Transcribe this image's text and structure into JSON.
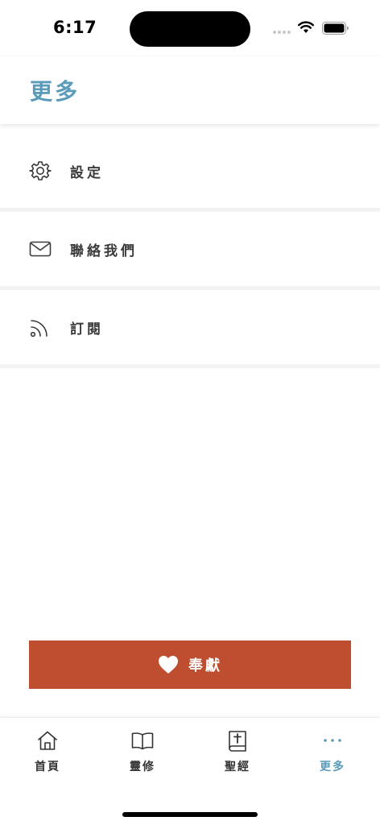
{
  "status_bar": {
    "time": "6:17"
  },
  "header": {
    "title": "更多"
  },
  "menu": {
    "items": [
      {
        "label": "設定",
        "icon": "gear-icon"
      },
      {
        "label": "聯絡我們",
        "icon": "mail-icon"
      },
      {
        "label": "訂閱",
        "icon": "rss-icon"
      }
    ]
  },
  "offering": {
    "label": "奉獻",
    "icon": "heart-icon"
  },
  "tab_bar": {
    "tabs": [
      {
        "label": "首頁",
        "icon": "home-icon"
      },
      {
        "label": "靈修",
        "icon": "book-icon"
      },
      {
        "label": "聖經",
        "icon": "bible-icon"
      },
      {
        "label": "更多",
        "icon": "more-icon",
        "active": true
      }
    ]
  },
  "colors": {
    "accent": "#5b9bba",
    "offering_button": "#bf4d30",
    "text": "#3a3a3a"
  }
}
